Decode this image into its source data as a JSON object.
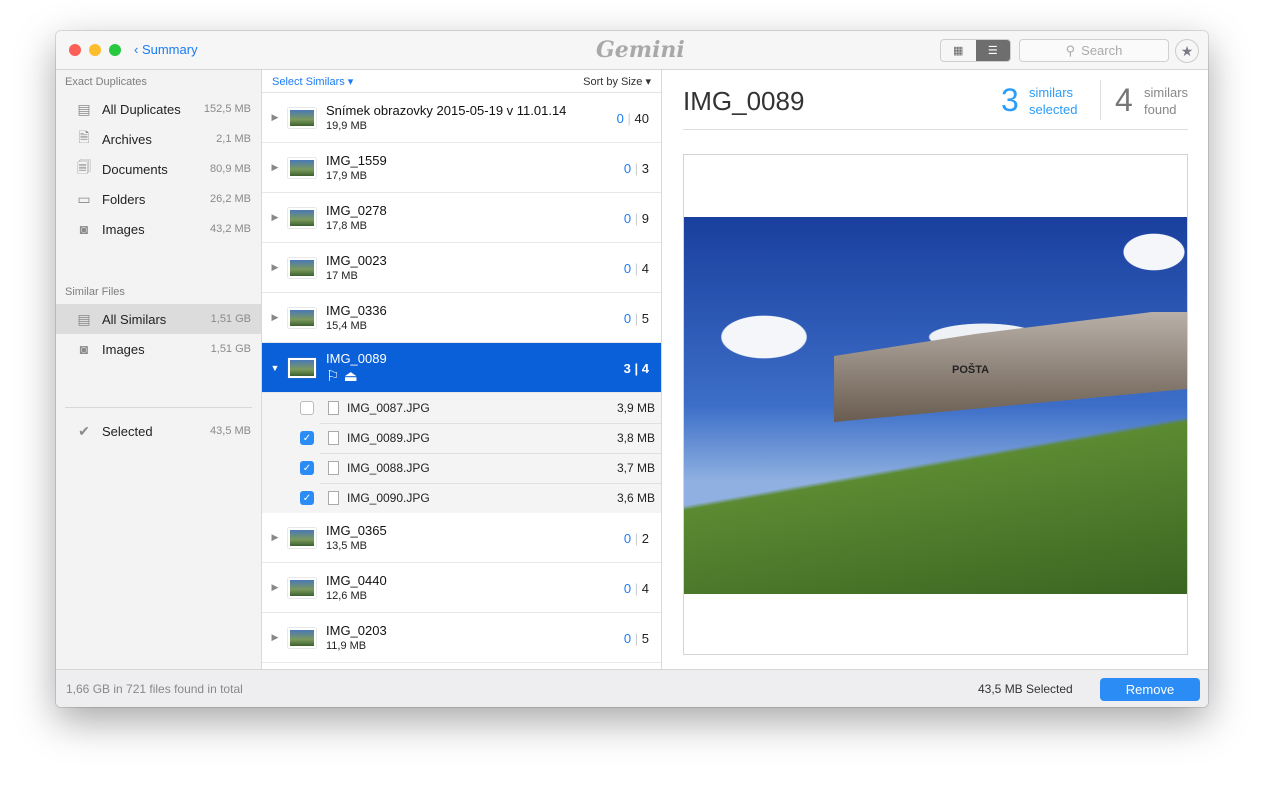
{
  "title": {
    "back": "Summary",
    "logo": "Gemini",
    "search_placeholder": "Search"
  },
  "sidebar": {
    "exact_header": "Exact Duplicates",
    "exact": [
      {
        "label": "All Duplicates",
        "size": "152,5 MB"
      },
      {
        "label": "Archives",
        "size": "2,1 MB"
      },
      {
        "label": "Documents",
        "size": "80,9 MB"
      },
      {
        "label": "Folders",
        "size": "26,2 MB"
      },
      {
        "label": "Images",
        "size": "43,2 MB"
      }
    ],
    "similar_header": "Similar Files",
    "similar": [
      {
        "label": "All Similars",
        "size": "1,51 GB"
      },
      {
        "label": "Images",
        "size": "1,51 GB"
      }
    ],
    "selected": {
      "label": "Selected",
      "size": "43,5 MB"
    }
  },
  "list": {
    "select_similars": "Select Similars ▾",
    "sort": "Sort by Size ▾",
    "groups_top": [
      {
        "name": "Snímek obrazovky 2015-05-19 v 11.01.14",
        "size": "19,9 MB",
        "sel": "0",
        "total": "40"
      },
      {
        "name": "IMG_1559",
        "size": "17,9 MB",
        "sel": "0",
        "total": "3"
      },
      {
        "name": "IMG_0278",
        "size": "17,8 MB",
        "sel": "0",
        "total": "9"
      },
      {
        "name": "IMG_0023",
        "size": "17 MB",
        "sel": "0",
        "total": "4"
      },
      {
        "name": "IMG_0336",
        "size": "15,4 MB",
        "sel": "0",
        "total": "5"
      }
    ],
    "active": {
      "name": "IMG_0089",
      "sel": "3",
      "total": "4"
    },
    "files": [
      {
        "name": "IMG_0087.JPG",
        "size": "3,9 MB",
        "checked": false
      },
      {
        "name": "IMG_0089.JPG",
        "size": "3,8 MB",
        "checked": true
      },
      {
        "name": "IMG_0088.JPG",
        "size": "3,7 MB",
        "checked": true
      },
      {
        "name": "IMG_0090.JPG",
        "size": "3,6 MB",
        "checked": true
      }
    ],
    "groups_bottom": [
      {
        "name": "IMG_0365",
        "size": "13,5 MB",
        "sel": "0",
        "total": "2"
      },
      {
        "name": "IMG_0440",
        "size": "12,6 MB",
        "sel": "0",
        "total": "4"
      },
      {
        "name": "IMG_0203",
        "size": "11,9 MB",
        "sel": "0",
        "total": "5"
      }
    ]
  },
  "detail": {
    "title": "IMG_0089",
    "selected_count": "3",
    "selected_l1": "similars",
    "selected_l2": "selected",
    "found_count": "4",
    "found_l1": "similars",
    "found_l2": "found",
    "photo_sign": "POŠTA"
  },
  "footer": {
    "total": "1,66 GB in 721 files found in total",
    "selected": "43,5 MB Selected",
    "remove": "Remove"
  }
}
